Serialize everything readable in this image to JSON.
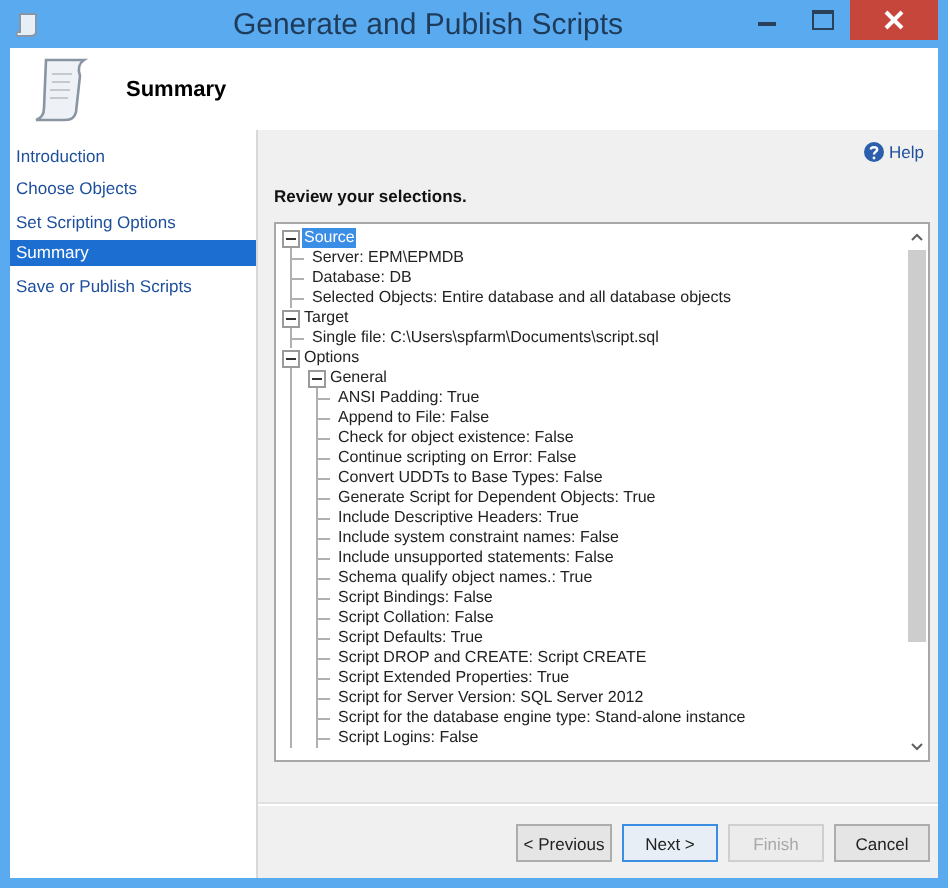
{
  "window": {
    "title": "Generate and Publish Scripts"
  },
  "header": {
    "title": "Summary"
  },
  "sidebar": {
    "items": [
      {
        "label": "Introduction",
        "selected": false
      },
      {
        "label": "Choose Objects",
        "selected": false
      },
      {
        "label": "Set Scripting Options",
        "selected": false
      },
      {
        "label": "Summary",
        "selected": true
      },
      {
        "label": "Save or Publish Scripts",
        "selected": false
      }
    ]
  },
  "help": {
    "label": "Help"
  },
  "instruction": "Review your selections.",
  "tree": [
    {
      "label": "Source",
      "selected": true,
      "expanded": true,
      "children": [
        {
          "label": "Server: EPM\\EPMDB",
          "selected": false
        },
        {
          "label": "Database: DB",
          "selected": false
        },
        {
          "label": "Selected Objects: Entire database and all database objects",
          "selected": false
        }
      ]
    },
    {
      "label": "Target",
      "selected": false,
      "expanded": true,
      "children": [
        {
          "label": "Single file: C:\\Users\\spfarm\\Documents\\script.sql",
          "selected": false
        }
      ]
    },
    {
      "label": "Options",
      "selected": false,
      "expanded": true,
      "children": [
        {
          "label": "General",
          "selected": false,
          "expanded": true,
          "children": [
            {
              "label": "ANSI Padding: True",
              "selected": false
            },
            {
              "label": "Append to File: False",
              "selected": false
            },
            {
              "label": "Check for object existence: False",
              "selected": false
            },
            {
              "label": "Continue scripting on Error: False",
              "selected": false
            },
            {
              "label": "Convert UDDTs to Base Types: False",
              "selected": false
            },
            {
              "label": "Generate Script for Dependent Objects: True",
              "selected": false
            },
            {
              "label": "Include Descriptive Headers: True",
              "selected": false
            },
            {
              "label": "Include system constraint names: False",
              "selected": false
            },
            {
              "label": "Include unsupported statements: False",
              "selected": false
            },
            {
              "label": "Schema qualify object names.: True",
              "selected": false
            },
            {
              "label": "Script Bindings: False",
              "selected": false
            },
            {
              "label": "Script Collation: False",
              "selected": false
            },
            {
              "label": "Script Defaults: True",
              "selected": false
            },
            {
              "label": "Script DROP and CREATE: Script CREATE",
              "selected": false
            },
            {
              "label": "Script Extended Properties: True",
              "selected": false
            },
            {
              "label": "Script for Server Version: SQL Server 2012",
              "selected": false
            },
            {
              "label": "Script for the database engine type: Stand-alone instance",
              "selected": false
            },
            {
              "label": "Script Logins: False",
              "selected": false
            }
          ]
        }
      ]
    }
  ],
  "buttons": [
    {
      "label": "< Previous",
      "disabled": false,
      "default": false
    },
    {
      "label": "Next >",
      "disabled": false,
      "default": true
    },
    {
      "label": "Finish",
      "disabled": true,
      "default": false
    },
    {
      "label": "Cancel",
      "disabled": false,
      "default": false
    }
  ]
}
